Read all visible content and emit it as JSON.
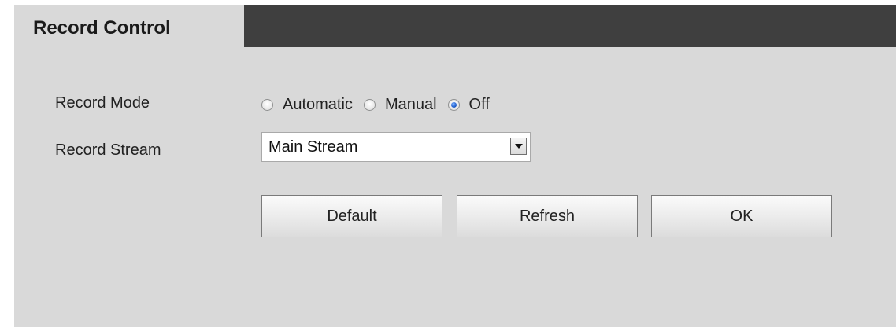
{
  "header": {
    "title": "Record Control"
  },
  "record_mode": {
    "label": "Record Mode",
    "options": [
      {
        "label": "Automatic",
        "checked": false
      },
      {
        "label": "Manual",
        "checked": false
      },
      {
        "label": "Off",
        "checked": true
      }
    ]
  },
  "record_stream": {
    "label": "Record Stream",
    "selected": "Main Stream"
  },
  "buttons": {
    "default_label": "Default",
    "refresh_label": "Refresh",
    "ok_label": "OK"
  },
  "colors": {
    "header_dark": "#3f3f3f",
    "panel_bg": "#d9d9d9",
    "radio_selected": "#1f5fcf"
  }
}
